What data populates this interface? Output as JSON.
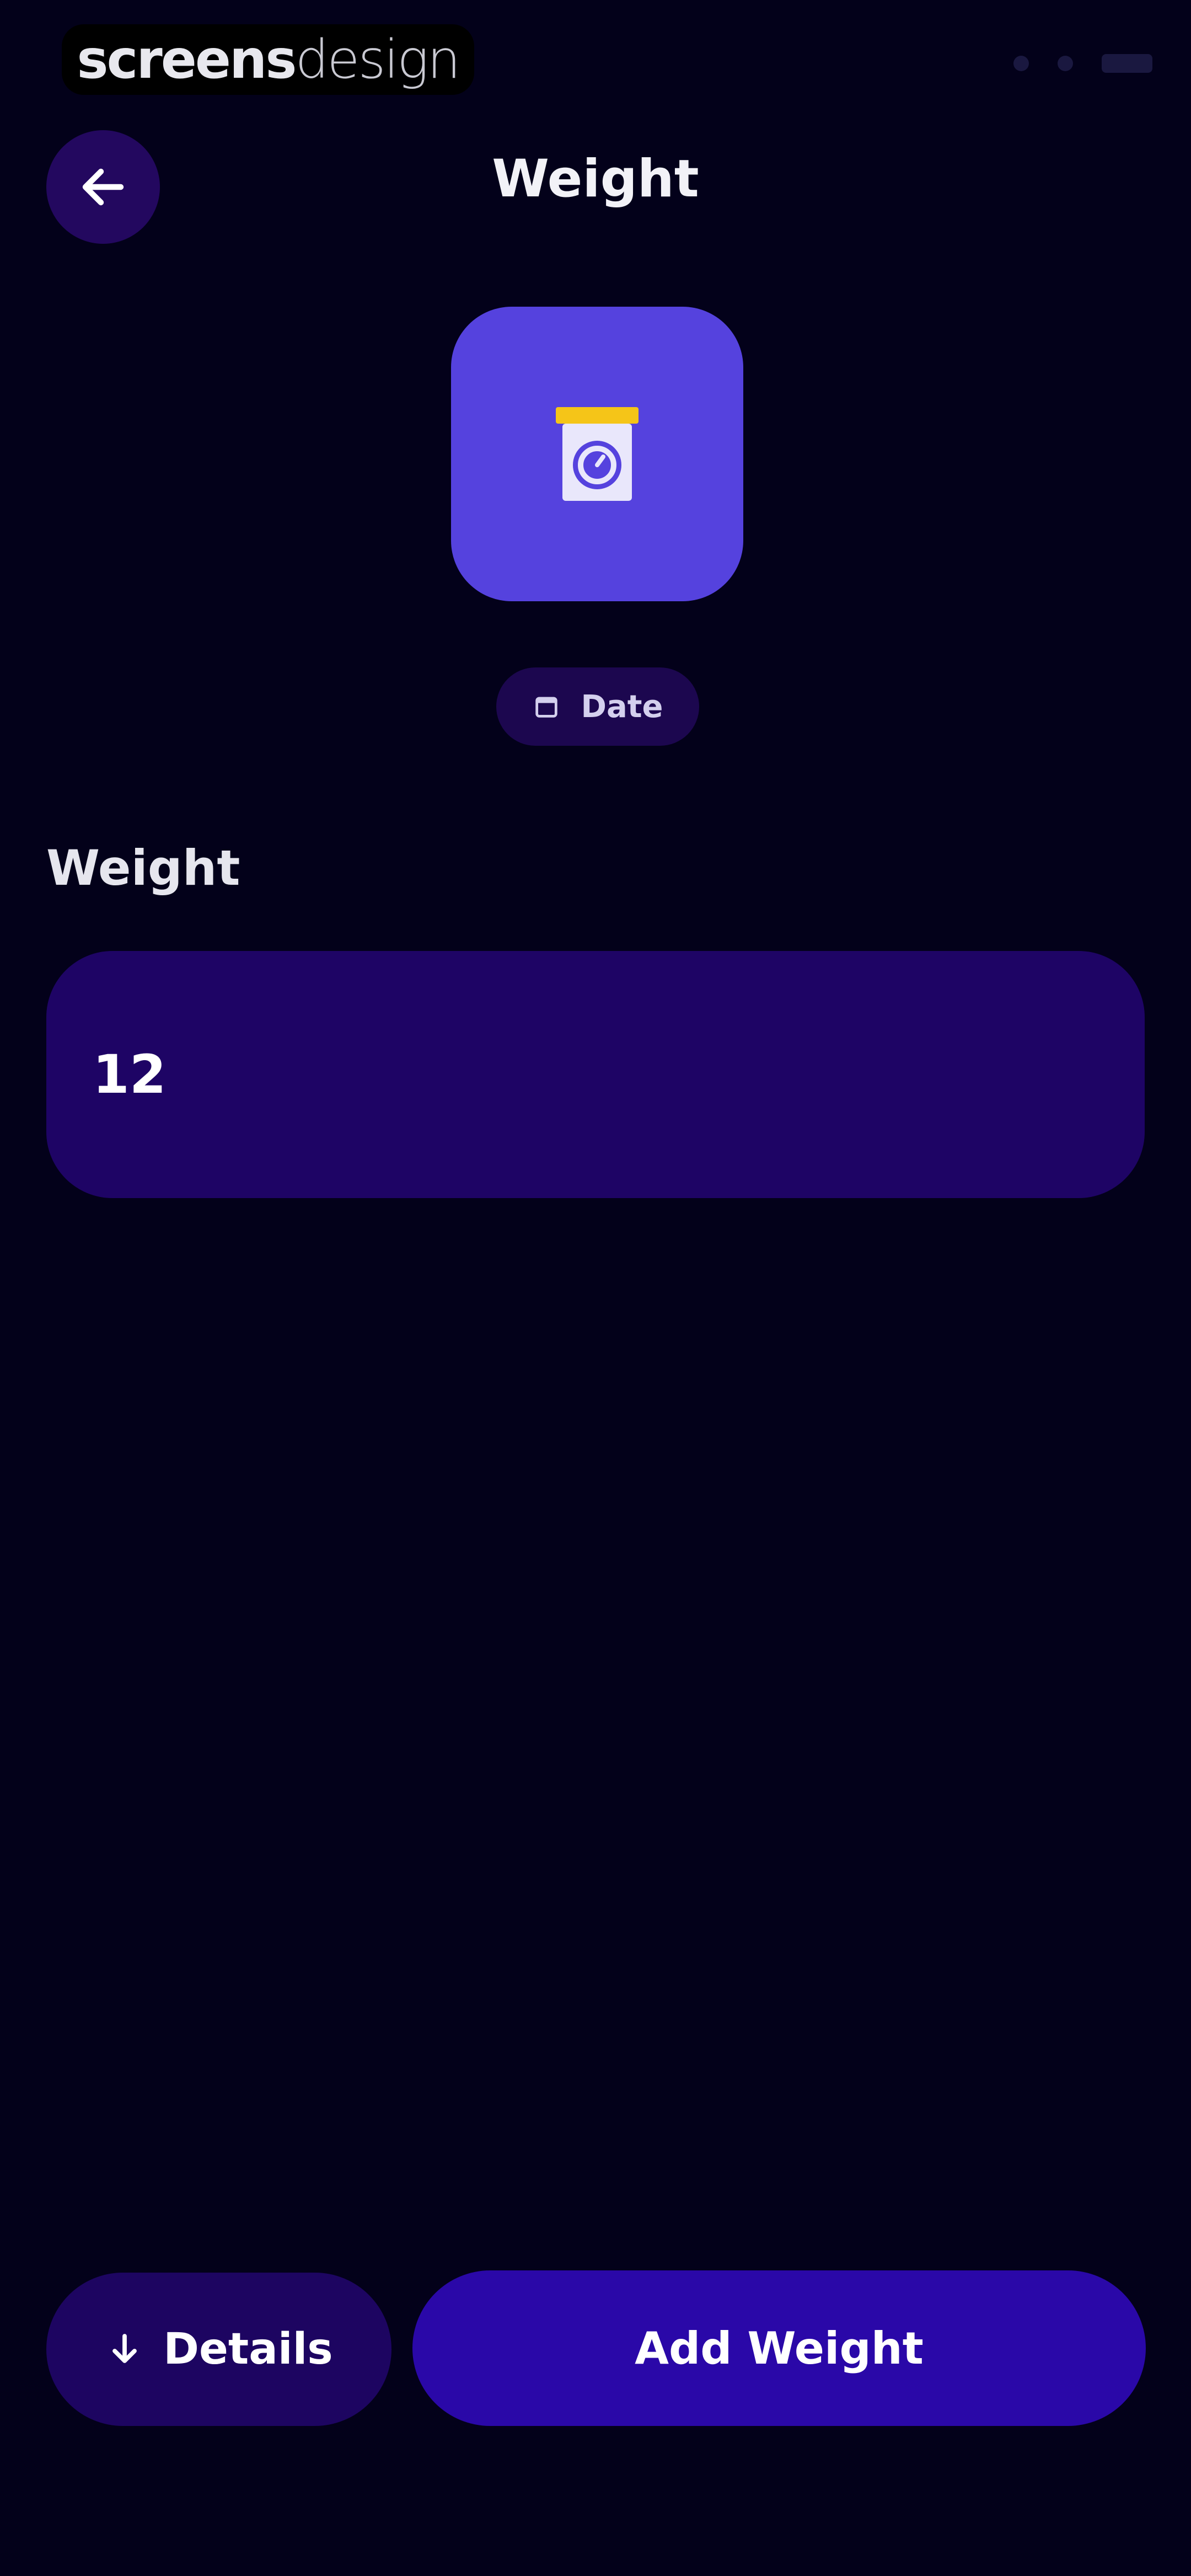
{
  "watermark": {
    "bold": "screens",
    "light": "design"
  },
  "header": {
    "title": "Weight",
    "back_icon": "arrow-left-icon"
  },
  "hero": {
    "icon": "scale-icon",
    "tile_color": "#5542de",
    "accent_color": "#f5c518"
  },
  "date_chip": {
    "label": "Date",
    "icon": "calendar-icon"
  },
  "form": {
    "weight_label": "Weight",
    "weight_value": "12"
  },
  "actions": {
    "details_label": "Details",
    "details_icon": "arrow-down-icon",
    "add_label": "Add Weight"
  },
  "colors": {
    "background": "#03011a",
    "surface": "#1e0465",
    "primary": "#2a08a8"
  }
}
